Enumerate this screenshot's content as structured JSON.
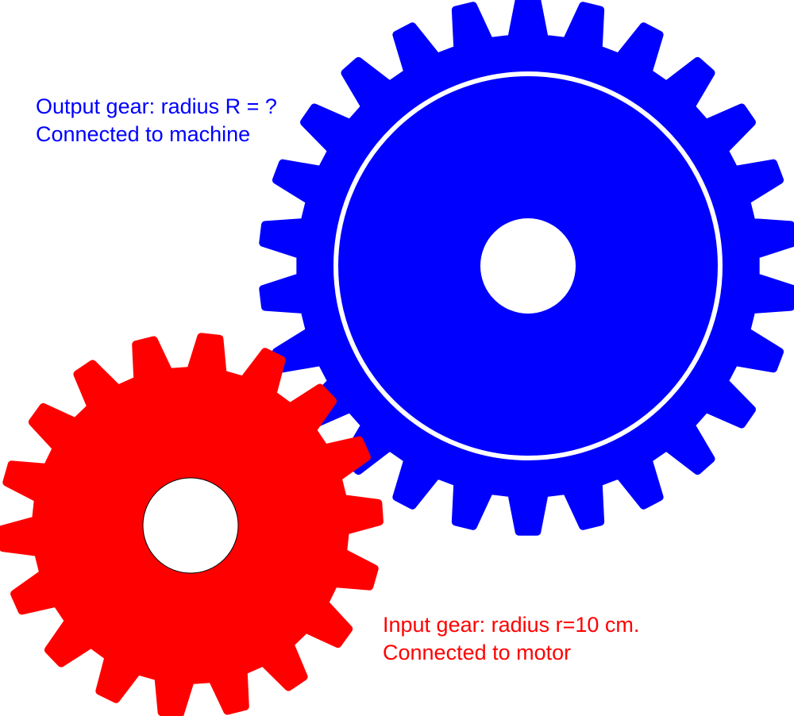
{
  "output_gear": {
    "line1": "Output gear: radius R = ?",
    "line2": "Connected to machine",
    "color": "#0000ff",
    "teeth": 26
  },
  "input_gear": {
    "line1": "Input gear: radius r=10 cm.",
    "line2": "Connected to motor",
    "color": "#ff0000",
    "teeth": 18
  }
}
